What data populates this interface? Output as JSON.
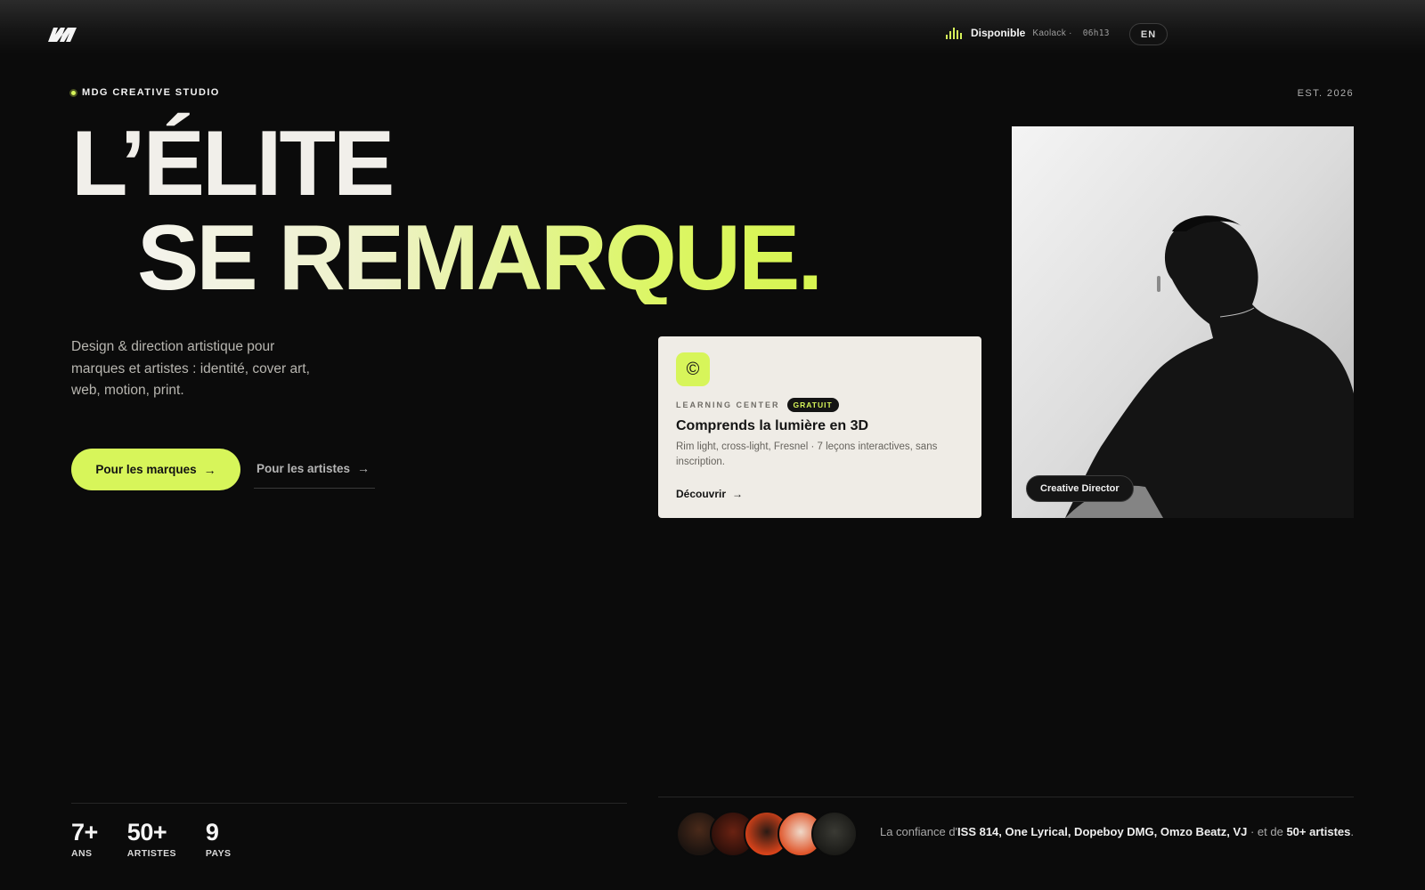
{
  "header": {
    "status_label": "Disponible",
    "status_city": "Kaolack ·",
    "status_time": "06h13",
    "lang_label": "EN",
    "accent_color": "#d7f55a"
  },
  "studio": {
    "name": "MDG CREATIVE STUDIO",
    "established": "EST. 2026"
  },
  "hero": {
    "line1": "L’ÉLITE",
    "line2": "SE REMARQUE.",
    "description": "Design & direction artistique pour marques et artistes : identité, cover art, web, motion, print."
  },
  "cta": {
    "brands_label": "Pour les marques",
    "artists_label": "Pour les artistes",
    "arrow": "→"
  },
  "card": {
    "icon": "copyright-icon",
    "icon_glyph": "©",
    "eyebrow": "LEARNING CENTER",
    "badge": "GRATUIT",
    "title": "Comprends la lumière en 3D",
    "text": "Rim light, cross-light, Fresnel · 7 leçons interactives, sans inscription.",
    "link_label": "Découvrir",
    "arrow": "→"
  },
  "portrait": {
    "role": "Creative Director"
  },
  "stats": [
    {
      "value": "7+",
      "label": "ANS"
    },
    {
      "value": "50+",
      "label": "ARTISTES"
    },
    {
      "value": "9",
      "label": "PAYS"
    }
  ],
  "trust": {
    "prefix": "La confiance d'",
    "names": "ISS 814, One Lyrical, Dopeboy DMG, Omzo Beatz, VJ",
    "middle": " · et de ",
    "count": "50+ artistes",
    "suffix": "."
  }
}
